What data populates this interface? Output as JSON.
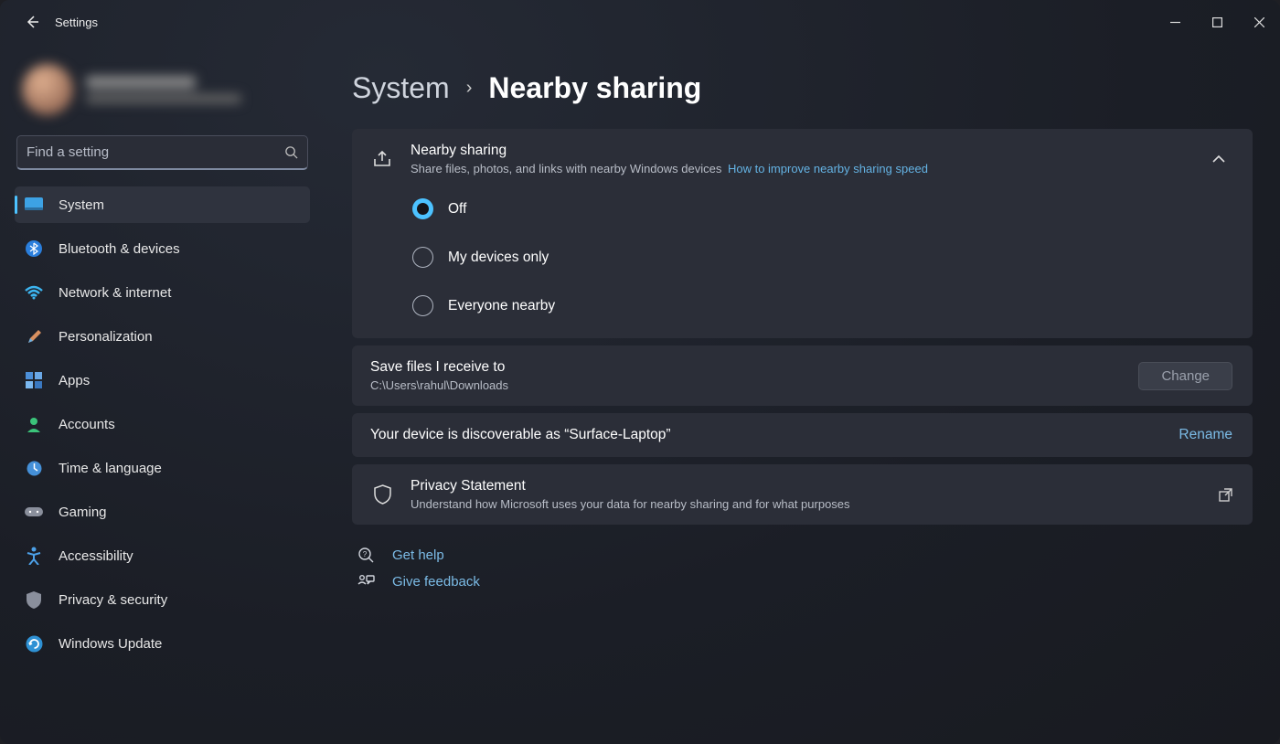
{
  "window": {
    "title": "Settings"
  },
  "search": {
    "placeholder": "Find a setting"
  },
  "sidebar": {
    "items": [
      {
        "label": "System"
      },
      {
        "label": "Bluetooth & devices"
      },
      {
        "label": "Network & internet"
      },
      {
        "label": "Personalization"
      },
      {
        "label": "Apps"
      },
      {
        "label": "Accounts"
      },
      {
        "label": "Time & language"
      },
      {
        "label": "Gaming"
      },
      {
        "label": "Accessibility"
      },
      {
        "label": "Privacy & security"
      },
      {
        "label": "Windows Update"
      }
    ]
  },
  "breadcrumb": {
    "parent": "System",
    "current": "Nearby sharing"
  },
  "nearby": {
    "title": "Nearby sharing",
    "subtitle": "Share files, photos, and links with nearby Windows devices",
    "help_link": "How to improve nearby sharing speed",
    "options": [
      {
        "label": "Off",
        "selected": true
      },
      {
        "label": "My devices only",
        "selected": false
      },
      {
        "label": "Everyone nearby",
        "selected": false
      }
    ]
  },
  "save": {
    "title": "Save files I receive to",
    "path": "C:\\Users\\rahul\\Downloads",
    "button": "Change"
  },
  "device": {
    "text": "Your device is discoverable as “Surface-Laptop”",
    "action": "Rename"
  },
  "privacy": {
    "title": "Privacy Statement",
    "subtitle": "Understand how Microsoft uses your data for nearby sharing and for what purposes"
  },
  "footer": {
    "help": "Get help",
    "feedback": "Give feedback"
  }
}
